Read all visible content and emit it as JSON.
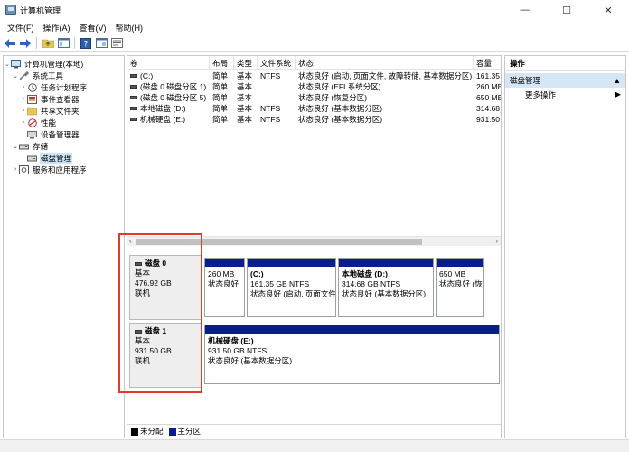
{
  "window": {
    "title": "计算机管理",
    "minimize": "—",
    "maximize": "☐",
    "close": "✕"
  },
  "menu": [
    "文件(F)",
    "操作(A)",
    "查看(V)",
    "帮助(H)"
  ],
  "toolbar": {
    "icons": [
      "back-icon",
      "forward-icon",
      "folder-up-icon",
      "show-hide-tree-icon",
      "help-icon",
      "properties-icon",
      "console-icon"
    ]
  },
  "tree": {
    "root": "计算机管理(本地)",
    "system_tools": "系统工具",
    "task_scheduler": "任务计划程序",
    "event_viewer": "事件查看器",
    "shared_folders": "共享文件夹",
    "performance": "性能",
    "device_manager": "设备管理器",
    "storage": "存储",
    "disk_management": "磁盘管理",
    "services": "服务和应用程序"
  },
  "volumes": {
    "headers": [
      "卷",
      "布局",
      "类型",
      "文件系统",
      "状态",
      "容量"
    ],
    "rows": [
      [
        "(C:)",
        "简单",
        "基本",
        "NTFS",
        "状态良好 (启动, 页面文件, 故障转储, 基本数据分区)",
        "161.35"
      ],
      [
        "(磁盘 0 磁盘分区 1)",
        "简单",
        "基本",
        "",
        "状态良好 (EFI 系统分区)",
        "260 ME"
      ],
      [
        "(磁盘 0 磁盘分区 5)",
        "简单",
        "基本",
        "",
        "状态良好 (恢复分区)",
        "650 ME"
      ],
      [
        "本地磁盘 (D:)",
        "简单",
        "基本",
        "NTFS",
        "状态良好 (基本数据分区)",
        "314.68"
      ],
      [
        "机械硬盘 (E:)",
        "简单",
        "基本",
        "NTFS",
        "状态良好 (基本数据分区)",
        "931.50"
      ]
    ]
  },
  "disks": [
    {
      "name": "磁盘 0",
      "type": "基本",
      "size": "476.92 GB",
      "status": "联机",
      "partitions": [
        {
          "name": "",
          "size": "260 MB",
          "status": "状态良好"
        },
        {
          "name": "(C:)",
          "size": "161.35 GB NTFS",
          "status": "状态良好 (启动, 页面文件"
        },
        {
          "name": "本地磁盘 (D:)",
          "size": "314.68 GB NTFS",
          "status": "状态良好 (基本数据分区)"
        },
        {
          "name": "",
          "size": "650 MB",
          "status": "状态良好 (恢"
        }
      ]
    },
    {
      "name": "磁盘 1",
      "type": "基本",
      "size": "931.50 GB",
      "status": "联机",
      "partitions": [
        {
          "name": "机械硬盘 (E:)",
          "size": "931.50 GB NTFS",
          "status": "状态良好 (基本数据分区)"
        }
      ]
    }
  ],
  "legend": {
    "unallocated": "未分配",
    "primary": "主分区",
    "unallocated_color": "#000000",
    "primary_color": "#0a1d8c"
  },
  "actions": {
    "header": "操作",
    "section": "磁盘管理",
    "more": "更多操作"
  }
}
